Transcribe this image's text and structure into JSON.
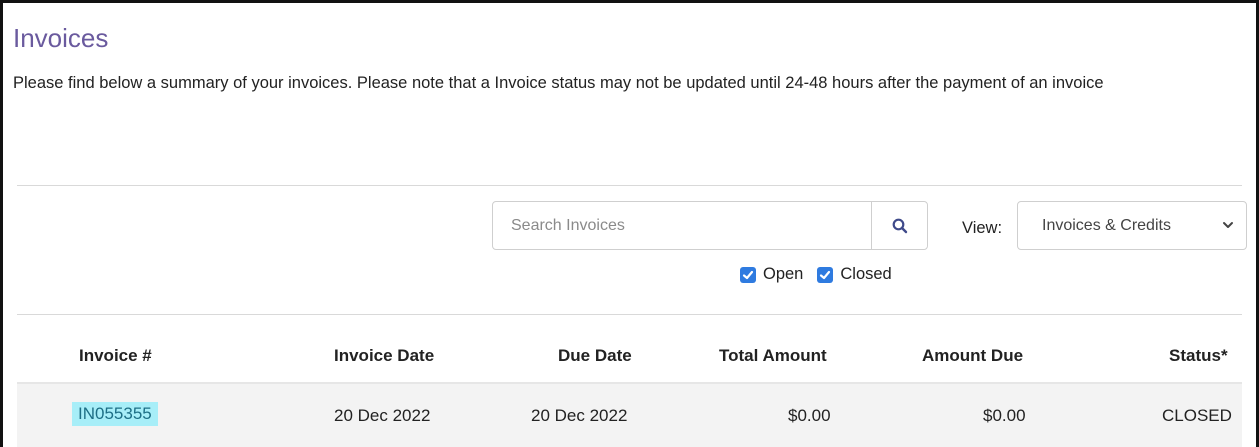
{
  "page": {
    "title": "Invoices",
    "intro": "Please find below a summary of your invoices. Please note that a Invoice status may not be updated until 24-48 hours after the payment of an invoice"
  },
  "search": {
    "placeholder": "Search Invoices",
    "button_icon": "search-icon"
  },
  "view": {
    "label": "View:",
    "selected": "Invoices & Credits"
  },
  "filters": [
    {
      "label": "Open",
      "checked": true
    },
    {
      "label": "Closed",
      "checked": true
    }
  ],
  "table": {
    "columns": [
      "Invoice #",
      "Invoice Date",
      "Due Date",
      "Total Amount",
      "Amount Due",
      "Status*"
    ],
    "rows": [
      {
        "invoice_no": "IN055355",
        "invoice_date": "20 Dec 2022",
        "due_date": "20 Dec 2022",
        "total_amount": "$0.00",
        "amount_due": "$0.00",
        "status": "CLOSED"
      }
    ]
  },
  "colors": {
    "title": "#6a5a9e",
    "checkbox": "#2f7be0",
    "link_highlight": "#a7eef8",
    "link_text": "#1d6f86"
  }
}
